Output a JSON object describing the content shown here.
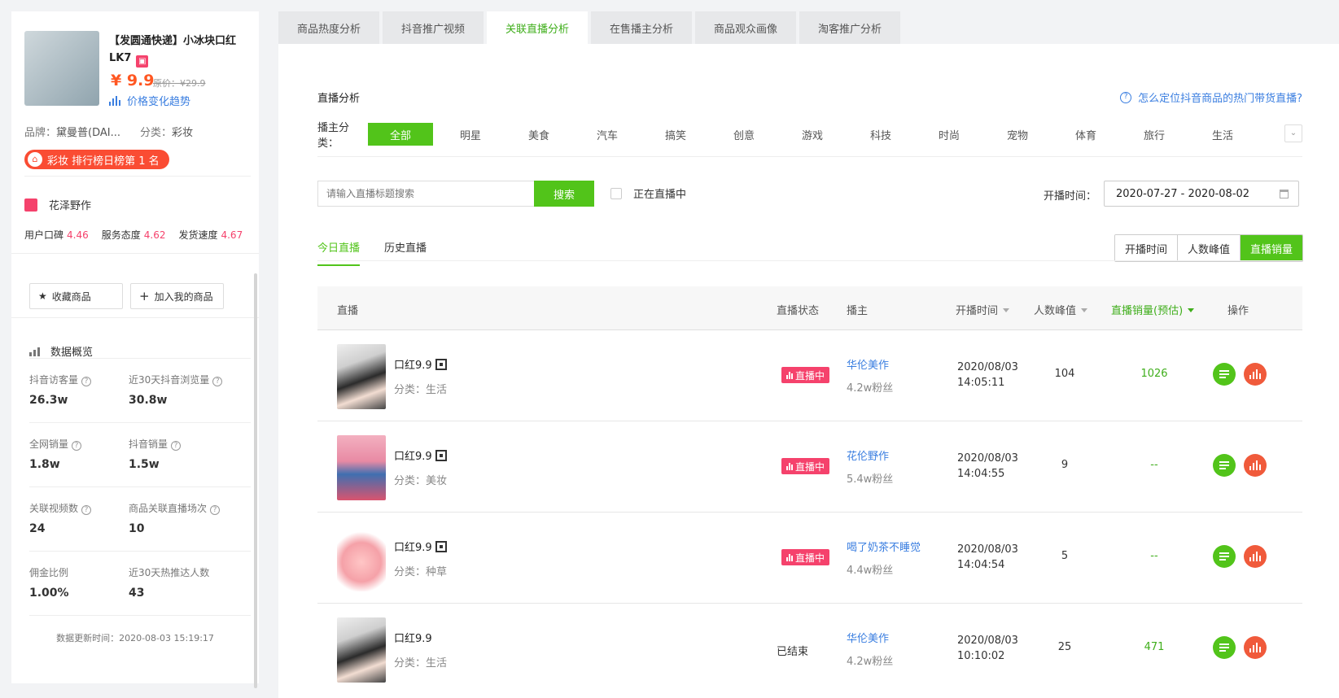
{
  "product": {
    "title": "【发圆通快递】小冰块口红LK7",
    "price": "¥ 9.9",
    "original_price": "原价：¥29.9",
    "trend_link": "价格变化趋势",
    "brand_key": "品牌：",
    "brand_val": "黛曼普(DAI...",
    "category_key": "分类：",
    "category_val": "彩妆",
    "rank_badge": "彩妆 排行榜日榜第 1 名",
    "rank_icon": "shopping-bag-icon"
  },
  "shop": {
    "name": "花泽野作",
    "scores": [
      {
        "label": "用户口碑",
        "value": "4.46"
      },
      {
        "label": "服务态度",
        "value": "4.62"
      },
      {
        "label": "发货速度",
        "value": "4.67"
      }
    ]
  },
  "actions": {
    "favorite": "收藏商品",
    "add": "加入我的商品"
  },
  "overview": {
    "title": "数据概览",
    "stats": [
      {
        "label": "抖音访客量",
        "value": "26.3w",
        "help": true
      },
      {
        "label": "近30天抖音浏览量",
        "value": "30.8w",
        "help": true
      },
      {
        "label": "全网销量",
        "value": "1.8w",
        "help": true
      },
      {
        "label": "抖音销量",
        "value": "1.5w",
        "help": true
      },
      {
        "label": "关联视频数",
        "value": "24",
        "help": true
      },
      {
        "label": "商品关联直播场次",
        "value": "10",
        "help": true
      },
      {
        "label": "佣金比例",
        "value": "1.00%",
        "help": false
      },
      {
        "label": "近30天热推达人数",
        "value": "43",
        "help": false
      }
    ],
    "update_time": "数据更新时间：2020-08-03 15:19:17"
  },
  "tabs": [
    "商品热度分析",
    "抖音推广视频",
    "关联直播分析",
    "在售播主分析",
    "商品观众画像",
    "淘客推广分析"
  ],
  "active_tab": 2,
  "section_title": "直播分析",
  "help_link": "怎么定位抖音商品的热门带货直播?",
  "category_filter": {
    "label": "播主分类：",
    "items": [
      "全部",
      "明星",
      "美食",
      "汽车",
      "搞笑",
      "创意",
      "游戏",
      "科技",
      "时尚",
      "宠物",
      "体育",
      "旅行",
      "生活"
    ]
  },
  "search": {
    "placeholder": "请输入直播标题搜索",
    "button": "搜索",
    "live_only": "正在直播中"
  },
  "date": {
    "label": "开播时间：",
    "range": "2020-07-27 - 2020-08-02"
  },
  "subtabs": [
    "今日直播",
    "历史直播"
  ],
  "sort_buttons": [
    "开播时间",
    "人数峰值",
    "直播销量"
  ],
  "table": {
    "headers": [
      "直播",
      "直播状态",
      "播主",
      "开播时间",
      "人数峰值",
      "直播销量(预估)",
      "操作"
    ],
    "rows": [
      {
        "title": "口红9.9",
        "category": "分类：生活",
        "status": "直播中",
        "live": true,
        "anchor": "华伦美作",
        "fans": "4.2w粉丝",
        "date": "2020/08/03",
        "time": "14:05:11",
        "peak": "104",
        "sales": "1026",
        "qr": true
      },
      {
        "title": "口红9.9",
        "category": "分类：美妆",
        "status": "直播中",
        "live": true,
        "anchor": "花伦野作",
        "fans": "5.4w粉丝",
        "date": "2020/08/03",
        "time": "14:04:55",
        "peak": "9",
        "sales": "--",
        "qr": true
      },
      {
        "title": "口红9.9",
        "category": "分类：种草",
        "status": "直播中",
        "live": true,
        "anchor": "喝了奶茶不睡觉",
        "fans": "4.4w粉丝",
        "date": "2020/08/03",
        "time": "14:04:54",
        "peak": "5",
        "sales": "--",
        "qr": true
      },
      {
        "title": "口红9.9",
        "category": "分类：生活",
        "status": "已结束",
        "live": false,
        "anchor": "华伦美作",
        "fans": "4.2w粉丝",
        "date": "2020/08/03",
        "time": "10:10:02",
        "peak": "25",
        "sales": "471",
        "qr": false
      }
    ]
  },
  "colors": {
    "accent_green": "#52c41a",
    "live_pink": "#f5426c",
    "link_blue": "#3a7ee0",
    "price_orange": "#ff5722"
  }
}
